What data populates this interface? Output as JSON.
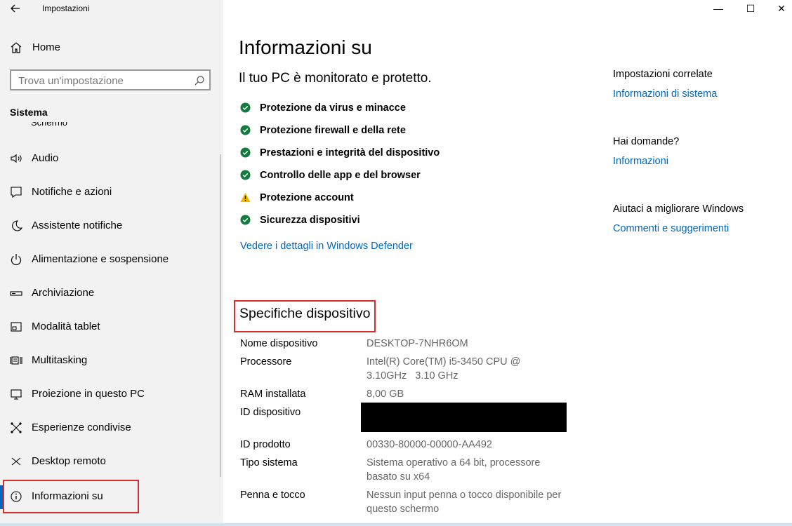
{
  "window": {
    "app_title": "Impostazioni",
    "controls": {
      "minimize": "—",
      "maximize": "☐",
      "close": "✕"
    }
  },
  "sidebar": {
    "home_label": "Home",
    "search_placeholder": "Trova un'impostazione",
    "section_title": "Sistema",
    "clipped_item": "Schermo",
    "items": [
      {
        "label": "Audio",
        "icon": "speaker-icon"
      },
      {
        "label": "Notifiche e azioni",
        "icon": "notification-icon"
      },
      {
        "label": "Assistente notifiche",
        "icon": "moon-icon"
      },
      {
        "label": "Alimentazione e sospensione",
        "icon": "power-icon"
      },
      {
        "label": "Archiviazione",
        "icon": "storage-icon"
      },
      {
        "label": "Modalità tablet",
        "icon": "tablet-icon"
      },
      {
        "label": "Multitasking",
        "icon": "multitasking-icon"
      },
      {
        "label": "Proiezione in questo PC",
        "icon": "projection-icon"
      },
      {
        "label": "Esperienze condivise",
        "icon": "share-icon"
      },
      {
        "label": "Desktop remoto",
        "icon": "remote-desktop-icon"
      },
      {
        "label": "Informazioni su",
        "icon": "info-icon",
        "selected": true
      }
    ]
  },
  "main": {
    "title": "Informazioni su",
    "subtitle": "Il tuo PC è monitorato e protetto.",
    "status": [
      {
        "label": "Protezione da virus e minacce",
        "state": "ok"
      },
      {
        "label": "Protezione firewall e della rete",
        "state": "ok"
      },
      {
        "label": "Prestazioni e integrità del dispositivo",
        "state": "ok"
      },
      {
        "label": "Controllo delle app e del browser",
        "state": "ok"
      },
      {
        "label": "Protezione account",
        "state": "warning"
      },
      {
        "label": "Sicurezza dispositivi",
        "state": "ok"
      }
    ],
    "defender_link": "Vedere i dettagli in Windows Defender",
    "specs_heading": "Specifiche dispositivo",
    "specs": [
      {
        "label": "Nome dispositivo",
        "value": "DESKTOP-7NHR6OM"
      },
      {
        "label": "Processore",
        "value": "Intel(R) Core(TM) i5-3450 CPU @ 3.10GHz   3.10 GHz"
      },
      {
        "label": "RAM installata",
        "value": "8,00 GB"
      },
      {
        "label": "ID dispositivo",
        "value": ""
      },
      {
        "label": "ID prodotto",
        "value": "00330-80000-00000-AA492"
      },
      {
        "label": "Tipo sistema",
        "value": "Sistema operativo a 64 bit, processore basato su x64"
      },
      {
        "label": "Penna e tocco",
        "value": "Nessun input penna o tocco disponibile per questo schermo"
      }
    ]
  },
  "related": {
    "heading1": "Impostazioni correlate",
    "link1": "Informazioni di sistema",
    "heading2": "Hai domande?",
    "link2": "Informazioni",
    "heading3": "Aiutaci a migliorare Windows",
    "link3": "Commenti e suggerimenti"
  },
  "colors": {
    "accent": "#0067c0",
    "ok": "#0f7b3f",
    "warning": "#f0b400",
    "highlight": "#d32f2f",
    "sidebar_bg": "#f2f2f2"
  }
}
